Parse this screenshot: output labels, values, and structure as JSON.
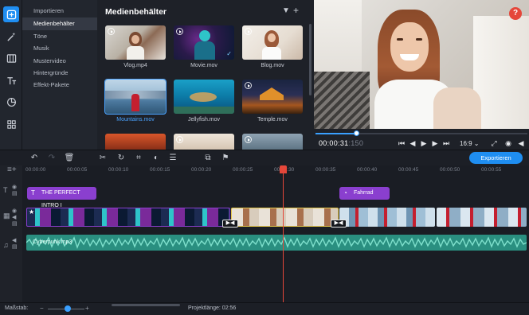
{
  "app": {
    "accent_color": "#1f8ef1",
    "title_clip_color": "#8a3fcf",
    "audio_color": "#2a8f80",
    "playhead_color": "#e5473a"
  },
  "rail": {
    "icons": [
      "import-icon",
      "magic-wand-icon",
      "transitions-icon",
      "titles-icon",
      "stickers-icon",
      "more-tools-icon"
    ]
  },
  "menu": {
    "items": [
      {
        "label": "Importieren"
      },
      {
        "label": "Medienbehälter"
      },
      {
        "label": "Töne"
      },
      {
        "label": "Musik"
      },
      {
        "label": "Mustervideo"
      },
      {
        "label": "Hintergründe"
      },
      {
        "label": "Effekt-Pakete"
      }
    ],
    "selected_index": 1
  },
  "media": {
    "title": "Medienbehälter",
    "items": [
      {
        "name": "Vlog.mp4"
      },
      {
        "name": "Movie.mov"
      },
      {
        "name": "Blog.mov"
      },
      {
        "name": "Mountains.mov"
      },
      {
        "name": "Jellyfish.mov"
      },
      {
        "name": "Temple.mov"
      }
    ]
  },
  "player": {
    "timecode_main": "00:00:31",
    "timecode_frames": ":150",
    "progress": 0.19,
    "aspect": "16:9",
    "help_label": "?"
  },
  "toolbar": {
    "export_label": "Exportieren"
  },
  "ruler": {
    "ticks": [
      "00:00:00",
      "00:00:05",
      "00:00:10",
      "00:00:15",
      "00:00:20",
      "00:00:25",
      "00:00:30",
      "00:00:35",
      "00:00:40",
      "00:00:45",
      "00:00:50",
      "00:00:55"
    ]
  },
  "timeline": {
    "title_clip_1": "THE PERFECT INTRO I",
    "title_clip_2": "Fahrrad",
    "audio_clip": "Cyberpunk.mp3"
  },
  "status": {
    "zoom_label": "Maßstab:",
    "project_length": "Projektlänge:  02:56"
  }
}
